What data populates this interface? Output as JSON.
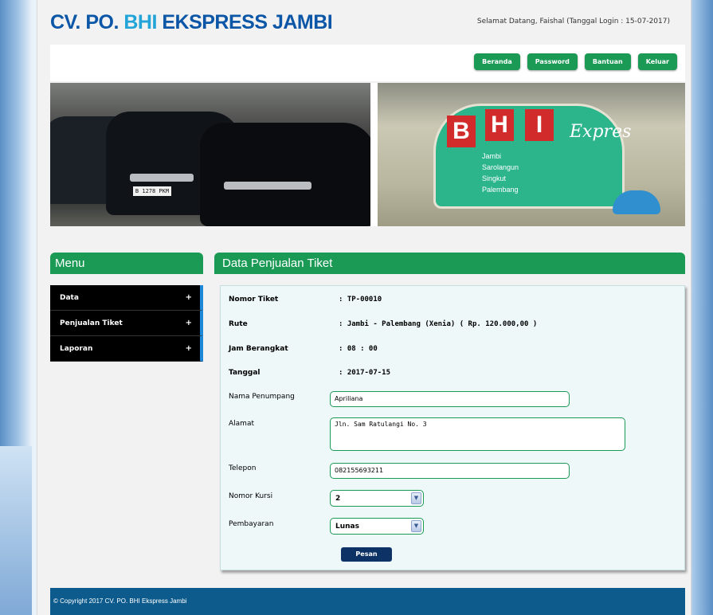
{
  "header": {
    "title_part1": "CV. PO. ",
    "title_part2": "BHI",
    "title_part3": " EKSPRESS JAMBI",
    "welcome": "Selamat Datang, Faishal (Tanggal Login : 15-07-2017)"
  },
  "nav": {
    "beranda": "Beranda",
    "password": "Password",
    "bantuan": "Bantuan",
    "keluar": "Keluar"
  },
  "banner": {
    "plate_text": "B 1278 PKM",
    "bhi_letters": [
      "B",
      "H",
      "I"
    ],
    "ekspres_text": "Expres",
    "routes": [
      "Jambi",
      "Sarolangun",
      "Singkut",
      "Palembang"
    ]
  },
  "sidebar": {
    "heading": "Menu",
    "items": [
      {
        "label": "Data",
        "expander": "+"
      },
      {
        "label": "Penjualan Tiket",
        "expander": "+"
      },
      {
        "label": "Laporan",
        "expander": "+"
      }
    ]
  },
  "main": {
    "heading": "Data Penjualan Tiket",
    "form": {
      "nomor_tiket_label": "Nomor Tiket",
      "nomor_tiket_value": ": TP-00010",
      "rute_label": "Rute",
      "rute_value": ": Jambi - Palembang (Xenia) ( Rp. 120.000,00 )",
      "jam_label": "Jam Berangkat",
      "jam_value": ": 08 : 00",
      "tanggal_label": "Tanggal",
      "tanggal_value": ": 2017-07-15",
      "nama_label": "Nama Penumpang",
      "nama_value": "Apriliana",
      "alamat_label": "Alamat",
      "alamat_value": "Jln. Sam Ratulangi No. 3",
      "telepon_label": "Telepon",
      "telepon_value": "082155693211",
      "kursi_label": "Nomor Kursi",
      "kursi_value": "2",
      "pembayaran_label": "Pembayaran",
      "pembayaran_value": "Lunas",
      "submit_label": "Pesan"
    }
  },
  "footer": {
    "text": "© Copyright 2017 CV. PO. BHI Ekspress Jambi"
  },
  "colors": {
    "brand_green": "#1a9a55",
    "title_blue": "#0b56a6",
    "title_accent": "#22a4d8",
    "footer_blue": "#0c5b8c",
    "submit_navy": "#0c3266"
  }
}
